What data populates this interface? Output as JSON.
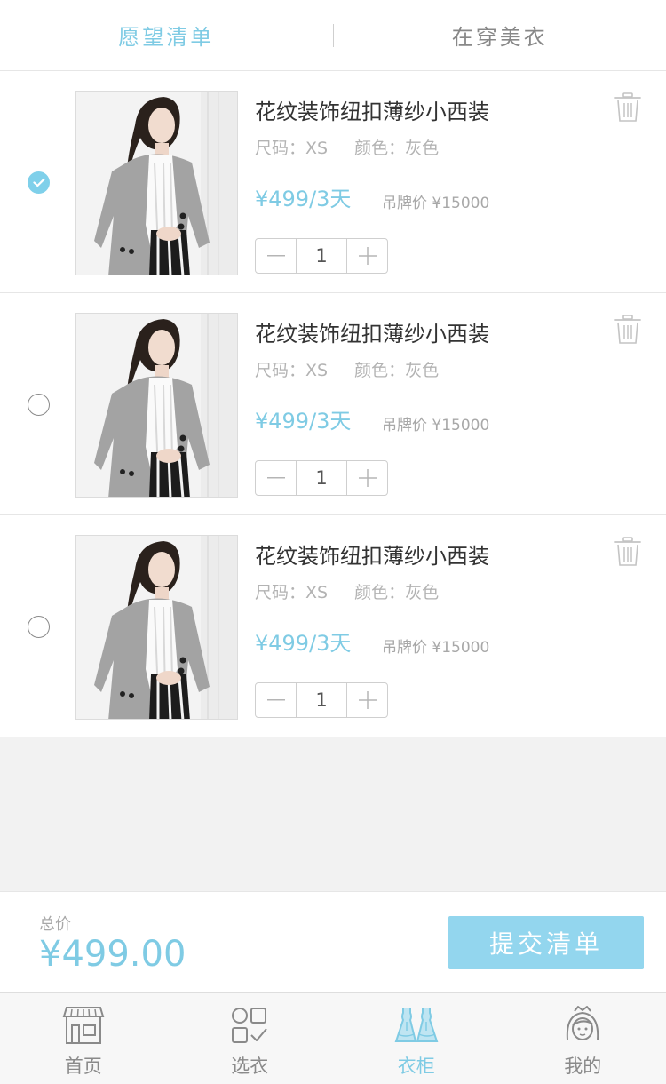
{
  "tabs": [
    {
      "label": "愿望清单",
      "active": true
    },
    {
      "label": "在穿美衣",
      "active": false
    }
  ],
  "items": [
    {
      "title": "花纹装饰纽扣薄纱小西装",
      "size_label": "尺码：",
      "size": "XS",
      "color_label": "颜色：",
      "color": "灰色",
      "price": "¥499/3天",
      "msrp_label": "吊牌价",
      "msrp": "¥15000",
      "quantity": "1",
      "selected": true
    },
    {
      "title": "花纹装饰纽扣薄纱小西装",
      "size_label": "尺码：",
      "size": "XS",
      "color_label": "颜色：",
      "color": "灰色",
      "price": "¥499/3天",
      "msrp_label": "吊牌价",
      "msrp": "¥15000",
      "quantity": "1",
      "selected": false
    },
    {
      "title": "花纹装饰纽扣薄纱小西装",
      "size_label": "尺码：",
      "size": "XS",
      "color_label": "颜色：",
      "color": "灰色",
      "price": "¥499/3天",
      "msrp_label": "吊牌价",
      "msrp": "¥15000",
      "quantity": "1",
      "selected": false
    }
  ],
  "footer": {
    "total_label": "总价",
    "total_value": "¥499.00",
    "submit_label": "提交清单"
  },
  "tabbar": [
    {
      "label": "首页",
      "icon": "store-icon",
      "active": false
    },
    {
      "label": "选衣",
      "icon": "category-grid-icon",
      "active": false
    },
    {
      "label": "衣柜",
      "icon": "wardrobe-dresses-icon",
      "active": true
    },
    {
      "label": "我的",
      "icon": "profile-girl-icon",
      "active": false
    }
  ],
  "colors": {
    "accent": "#7fcbe4",
    "submit_bg": "#93d6ee",
    "muted_text": "#b3b3b3",
    "page_bg": "#f2f2f2"
  }
}
